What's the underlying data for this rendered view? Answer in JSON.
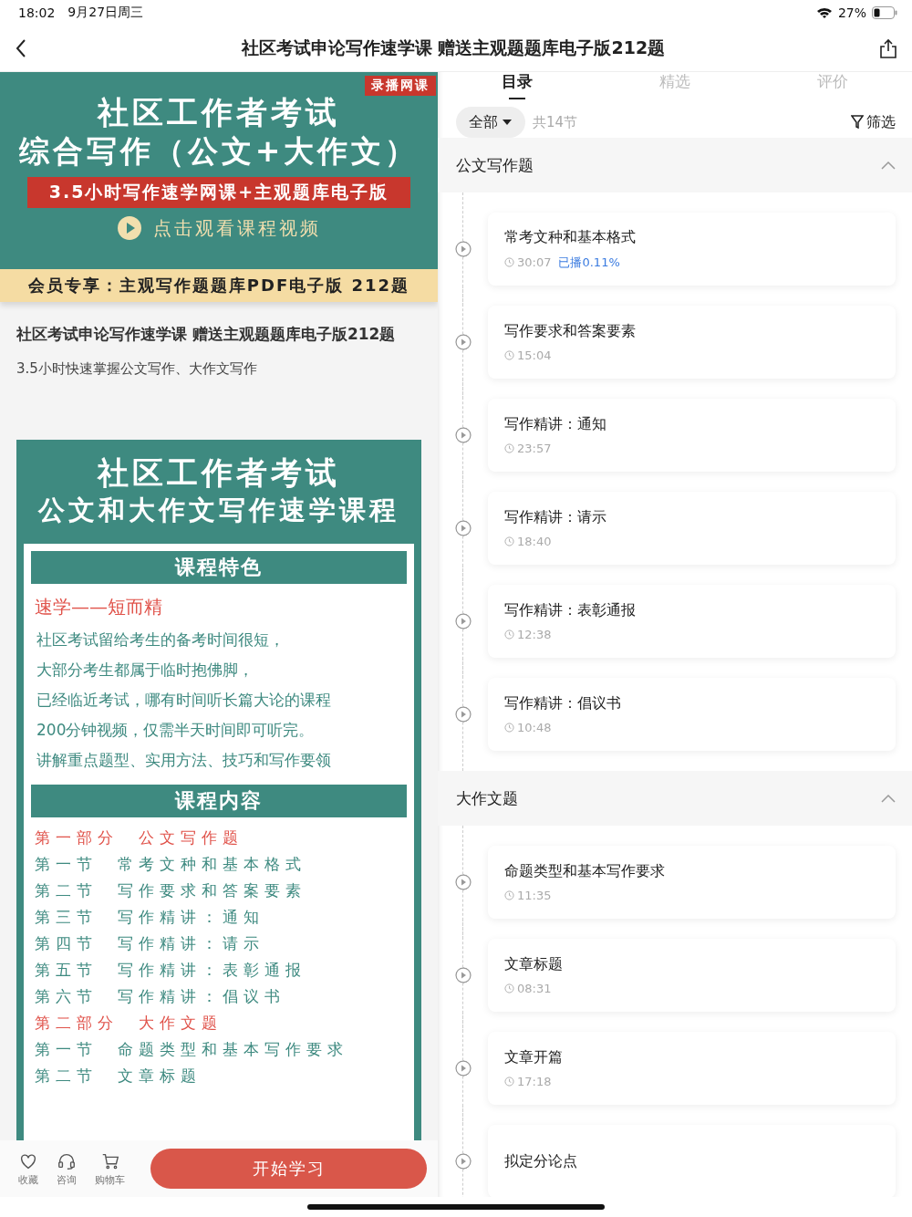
{
  "status_bar": {
    "time": "18:02",
    "date": "9月27日周三",
    "battery": "27%"
  },
  "nav": {
    "title": "社区考试申论写作速学课 赠送主观题题库电子版212题"
  },
  "banner": {
    "badge": "录播网课",
    "title_lines": [
      "社区工作者考试",
      "综合写作（公文+大作文）"
    ],
    "red_strip": "3.5小时写作速学网课+主观题库电子版",
    "play_text": "点击观看课程视频",
    "member_strip": "会员专享：主观写作题题库PDF电子版 212题"
  },
  "course": {
    "title": "社区考试申论写作速学课 赠送主观题题库电子版212题",
    "subtitle": "3.5小时快速掌握公文写作、大作文写作"
  },
  "poster": {
    "title_lines": [
      "社区工作者考试",
      "公文和大作文写作速学课程"
    ],
    "features_heading": "课程特色",
    "feature_highlight": "速学——短而精",
    "feature_lines": [
      "社区考试留给考生的备考时间很短，",
      "大部分考生都属于临时抱佛脚，",
      "已经临近考试，哪有时间听长篇大论的课程",
      "200分钟视频，仅需半天时间即可听完。",
      "讲解重点题型、实用方法、技巧和写作要领"
    ],
    "content_heading": "课程内容",
    "content_lines": [
      {
        "kind": "part",
        "label": "第一部分",
        "text": "公文写作题"
      },
      {
        "kind": "section",
        "label": "第一节",
        "text": "常考文种和基本格式"
      },
      {
        "kind": "section",
        "label": "第二节",
        "text": "写作要求和答案要素"
      },
      {
        "kind": "section",
        "label": "第三节",
        "text": "写作精讲：通知"
      },
      {
        "kind": "section",
        "label": "第四节",
        "text": "写作精讲：请示"
      },
      {
        "kind": "section",
        "label": "第五节",
        "text": "写作精讲：表彰通报"
      },
      {
        "kind": "section",
        "label": "第六节",
        "text": "写作精讲：倡议书"
      },
      {
        "kind": "part",
        "label": "第二部分",
        "text": "大作文题"
      },
      {
        "kind": "section",
        "label": "第一节",
        "text": "命题类型和基本写作要求"
      },
      {
        "kind": "section",
        "label": "第二节",
        "text": "文章标题"
      }
    ]
  },
  "bottom_bar": {
    "actions": [
      {
        "kind": "heart",
        "label": "收藏"
      },
      {
        "kind": "headset",
        "label": "咨询"
      },
      {
        "kind": "cart",
        "label": "购物车"
      }
    ],
    "start_button": "开始学习"
  },
  "tabs": [
    {
      "label": "目录",
      "selected": true
    },
    {
      "label": "精选",
      "selected": false
    },
    {
      "label": "评价",
      "selected": false
    }
  ],
  "filter": {
    "dropdown": "全部",
    "count": "共14节",
    "filter_label": "筛选"
  },
  "sections": [
    {
      "title": "公文写作题",
      "expanded": true,
      "lessons": [
        {
          "title": "常考文种和基本格式",
          "duration": "30:07",
          "progress": "已播0.11%",
          "played": true
        },
        {
          "title": "写作要求和答案要素",
          "duration": "15:04"
        },
        {
          "title": "写作精讲：通知",
          "duration": "23:57"
        },
        {
          "title": "写作精讲：请示",
          "duration": "18:40"
        },
        {
          "title": "写作精讲：表彰通报",
          "duration": "12:38"
        },
        {
          "title": "写作精讲：倡议书",
          "duration": "10:48"
        }
      ]
    },
    {
      "title": "大作文题",
      "expanded": true,
      "lessons": [
        {
          "title": "命题类型和基本写作要求",
          "duration": "11:35"
        },
        {
          "title": "文章标题",
          "duration": "08:31"
        },
        {
          "title": "文章开篇",
          "duration": "17:18"
        },
        {
          "title": "拟定分论点"
        }
      ]
    }
  ]
}
